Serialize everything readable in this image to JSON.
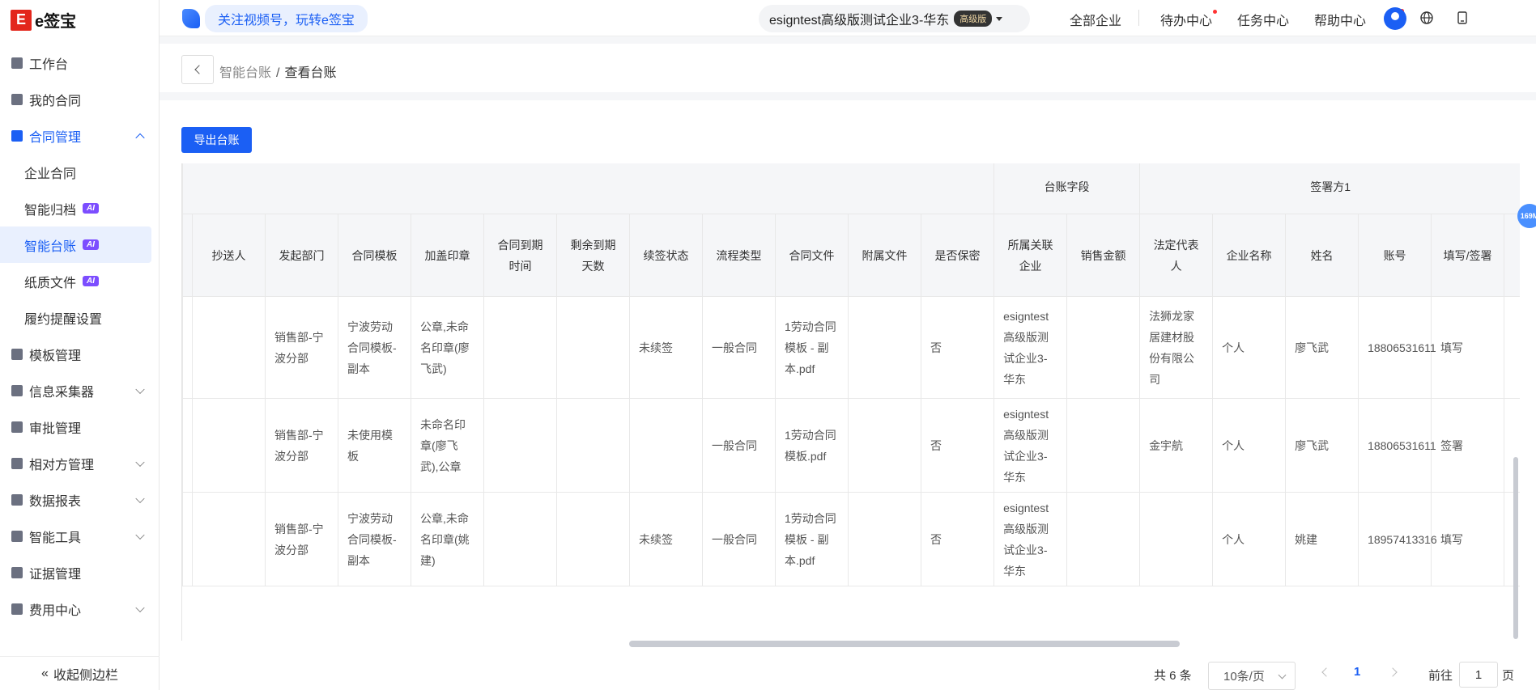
{
  "brand": {
    "logo_glyph": "E",
    "name": "e签宝"
  },
  "sidebar": {
    "items": [
      {
        "label": "工作台"
      },
      {
        "label": "我的合同"
      },
      {
        "label": "合同管理"
      },
      {
        "label": "企业合同"
      },
      {
        "label": "智能归档",
        "badge": "AI"
      },
      {
        "label": "智能台账",
        "badge": "AI"
      },
      {
        "label": "纸质文件",
        "badge": "AI"
      },
      {
        "label": "履约提醒设置"
      },
      {
        "label": "模板管理"
      },
      {
        "label": "信息采集器"
      },
      {
        "label": "审批管理"
      },
      {
        "label": "相对方管理"
      },
      {
        "label": "数据报表"
      },
      {
        "label": "智能工具"
      },
      {
        "label": "证据管理"
      },
      {
        "label": "费用中心"
      }
    ],
    "collapse_label": "收起侧边栏"
  },
  "topbar": {
    "promo": "关注视频号，玩转e签宝",
    "org_name": "esigntest高级版测试企业3-华东",
    "org_badge": "高级版",
    "links": [
      "全部企业",
      "待办中心",
      "任务中心",
      "帮助中心"
    ]
  },
  "breadcrumb": {
    "parent": "智能台账",
    "current": "查看台账"
  },
  "toolbar": {
    "export_label": "导出台账"
  },
  "table": {
    "group_headers": {
      "ledger_fields": "台账字段",
      "signer1": "签署方1"
    },
    "columns": [
      "抄送人",
      "发起部门",
      "合同模板",
      "加盖印章",
      "合同到期时间",
      "剩余到期天数",
      "续签状态",
      "流程类型",
      "合同文件",
      "附属文件",
      "是否保密",
      "所属关联企业",
      "销售金额",
      "法定代表人",
      "企业名称",
      "姓名",
      "账号",
      "填写/签署"
    ],
    "rows": [
      [
        "",
        "销售部-宁波分部",
        "宁波劳动合同模板-副本",
        "公章,未命名印章(廖飞武)",
        "",
        "",
        "未续签",
        "一般合同",
        "1劳动合同模板 - 副本.pdf",
        "",
        "否",
        "esigntest高级版测试企业3-华东",
        "",
        "法狮龙家居建材股份有限公司",
        "个人",
        "廖飞武",
        "18806531611",
        "填写"
      ],
      [
        "",
        "销售部-宁波分部",
        "未使用模板",
        "未命名印章(廖飞武),公章",
        "",
        "",
        "",
        "一般合同",
        "1劳动合同模板.pdf",
        "",
        "否",
        "esigntest高级版测试企业3-华东",
        "",
        "金宇航",
        "个人",
        "廖飞武",
        "18806531611",
        "签署"
      ],
      [
        "",
        "销售部-宁波分部",
        "宁波劳动合同模板-副本",
        "公章,未命名印章(姚建)",
        "",
        "",
        "未续签",
        "一般合同",
        "1劳动合同模板 - 副本.pdf",
        "",
        "否",
        "esigntest高级版测试企业3-华东",
        "",
        "",
        "个人",
        "姚建",
        "18957413316",
        "填写"
      ]
    ]
  },
  "float_badge": "169M",
  "pagination": {
    "total": "共 6 条",
    "page_size": "10条/页",
    "current_page": "1",
    "goto_label": "前往",
    "goto_value": "1",
    "page_suffix": "页"
  },
  "colors": {
    "accent": "#1b5ff4",
    "ai_badge": "#7c4dff",
    "brand": "#e3261c"
  }
}
